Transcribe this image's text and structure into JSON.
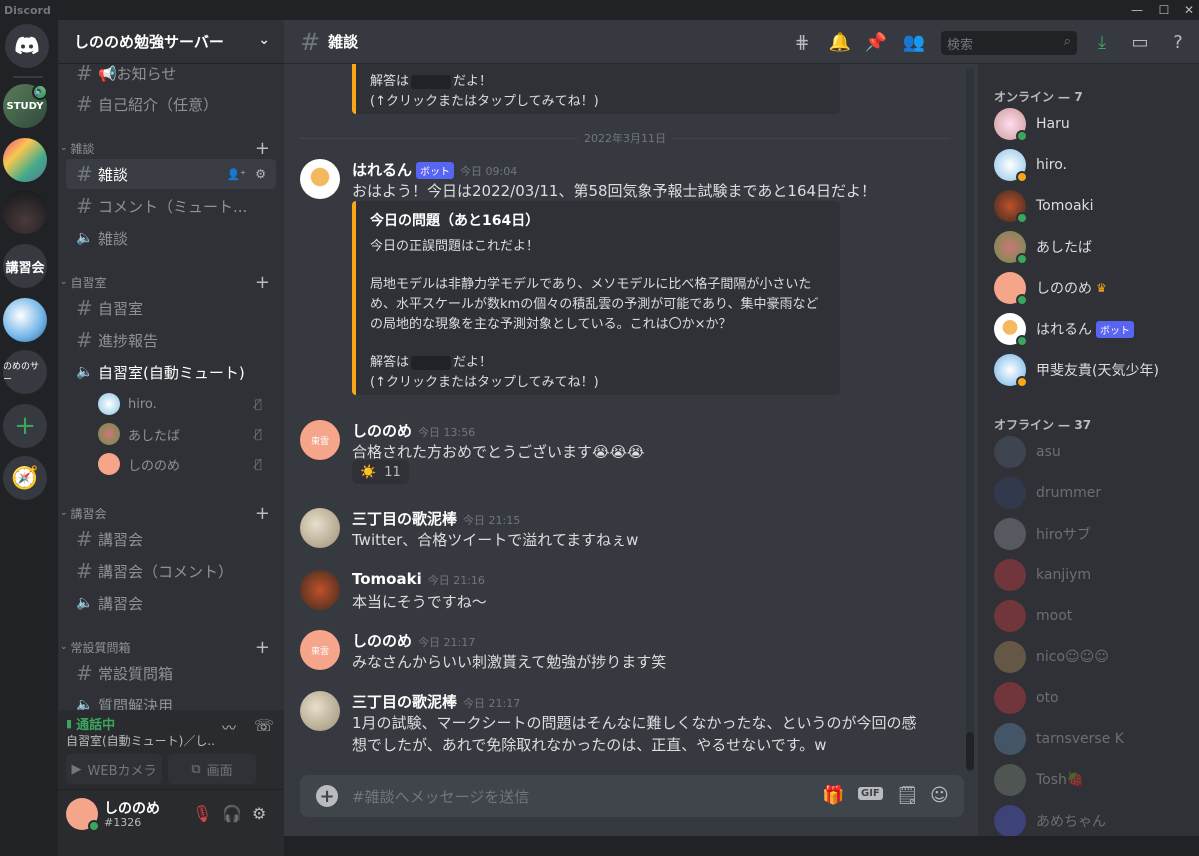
{
  "window": {
    "title": "Discord",
    "controls": [
      "minimize",
      "maximize",
      "close"
    ]
  },
  "guilds": {
    "home": "discord-home",
    "servers": [
      {
        "name": "STUDY",
        "speaking": true
      },
      {
        "name": "color-blocks"
      },
      {
        "name": "night-tree"
      },
      {
        "name": "講習会"
      },
      {
        "name": "sky"
      },
      {
        "name": "のめのサー"
      }
    ],
    "add": "+",
    "explore": "compass"
  },
  "server": {
    "name": "しののめ勉強サーバー"
  },
  "channels": [
    {
      "type": "text",
      "label": "📢お知らせ"
    },
    {
      "type": "text",
      "label": "自己紹介（任意）"
    },
    {
      "type": "category",
      "label": "雑談"
    },
    {
      "type": "text",
      "label": "雑談",
      "active": true
    },
    {
      "type": "text",
      "label": "コメント（ミュート..."
    },
    {
      "type": "voice",
      "label": "雑談"
    },
    {
      "type": "category",
      "label": "自習室"
    },
    {
      "type": "text",
      "label": "自習室"
    },
    {
      "type": "text",
      "label": "進捗報告"
    },
    {
      "type": "voice",
      "label": "自習室(自動ミュート)"
    },
    {
      "type": "category",
      "label": "講習会"
    },
    {
      "type": "text",
      "label": "講習会"
    },
    {
      "type": "text",
      "label": "講習会（コメント）"
    },
    {
      "type": "voice",
      "label": "講習会"
    },
    {
      "type": "category",
      "label": "常設質問箱"
    },
    {
      "type": "text",
      "label": "常設質問箱"
    },
    {
      "type": "voice",
      "label": "質問解決用"
    }
  ],
  "voice_users": [
    {
      "name": "hiro."
    },
    {
      "name": "あしたば"
    },
    {
      "name": "しののめ"
    }
  ],
  "voice_panel": {
    "status": "通話中",
    "channel": "自習室(自動ミュート)／し...",
    "camera": "WEBカメラ",
    "screen": "画面"
  },
  "user": {
    "name": "しののめ",
    "tag": "#1326"
  },
  "header": {
    "channel": "雑談",
    "search_placeholder": "検索"
  },
  "messages": [
    {
      "embed_tail": {
        "answer_label": "解答は",
        "answer_suffix": "だよ！",
        "hint": "(↑クリックまたはタップしてみてね！)"
      }
    },
    {
      "date_divider": "2022年3月11日"
    },
    {
      "author": "はれるん",
      "bot": "ボット",
      "time": "今日 09:04",
      "text": "おはよう！今日は2022/03/11、第58回気象予報士試験まであと164日だよ！",
      "embed": {
        "title": "今日の問題（あと164日）",
        "line1": "今日の正誤問題はこれだよ！",
        "line2": "局地モデルは非静力学モデルであり、メソモデルに比べ格子間隔が小さいため、水平スケールが数kmの個々の積乱雲の予測が可能であり、集中豪雨などの局地的な現象を主な予測対象としている。これは〇か×か？",
        "answer_label": "解答は",
        "answer_suffix": "だよ！",
        "hint": "(↑クリックまたはタップしてみてね！)"
      }
    },
    {
      "author": "しののめ",
      "time": "今日 13:56",
      "text": "合格された方おめでとうございます😭😭😭",
      "reaction": {
        "emoji": "☀️",
        "count": "11"
      }
    },
    {
      "author": "三丁目の歌泥棒",
      "time": "今日 21:15",
      "text": "Twitter、合格ツイートで溢れてますねぇw"
    },
    {
      "author": "Tomoaki",
      "time": "今日 21:16",
      "text": "本当にそうですね〜"
    },
    {
      "author": "しののめ",
      "time": "今日 21:17",
      "text": "みなさんからいい刺激貰えて勉強が捗ります笑"
    },
    {
      "author": "三丁目の歌泥棒",
      "time": "今日 21:17",
      "text": "1月の試験、マークシートの問題はそんなに難しくなかったな、というのが今回の感想でしたが、あれで免除取れなかったのは、正直、やるせないです。w"
    }
  ],
  "composer": {
    "placeholder": "#雑談へメッセージを送信",
    "gif": "GIF"
  },
  "members": {
    "online_header": "オンライン — 7",
    "online": [
      {
        "name": "Haru"
      },
      {
        "name": "hiro."
      },
      {
        "name": "Tomoaki"
      },
      {
        "name": "あしたば"
      },
      {
        "name": "しののめ",
        "crown": true
      },
      {
        "name": "はれるん",
        "bot": "ボット"
      },
      {
        "name": "甲斐友貴(天気少年)"
      }
    ],
    "offline_header": "オフライン — 37",
    "offline": [
      {
        "name": "asu"
      },
      {
        "name": "drummer"
      },
      {
        "name": "hiroサブ"
      },
      {
        "name": "kanjiym"
      },
      {
        "name": "moot"
      },
      {
        "name": "nico☺☺☺"
      },
      {
        "name": "oto"
      },
      {
        "name": "tarnsverse K"
      },
      {
        "name": "Tosh🍓"
      },
      {
        "name": "あめちゃん"
      }
    ]
  },
  "colors": {
    "accent": "#5865f2",
    "online": "#3ba55d",
    "embed_bar": "#faa61a",
    "download": "#3ba55d"
  }
}
